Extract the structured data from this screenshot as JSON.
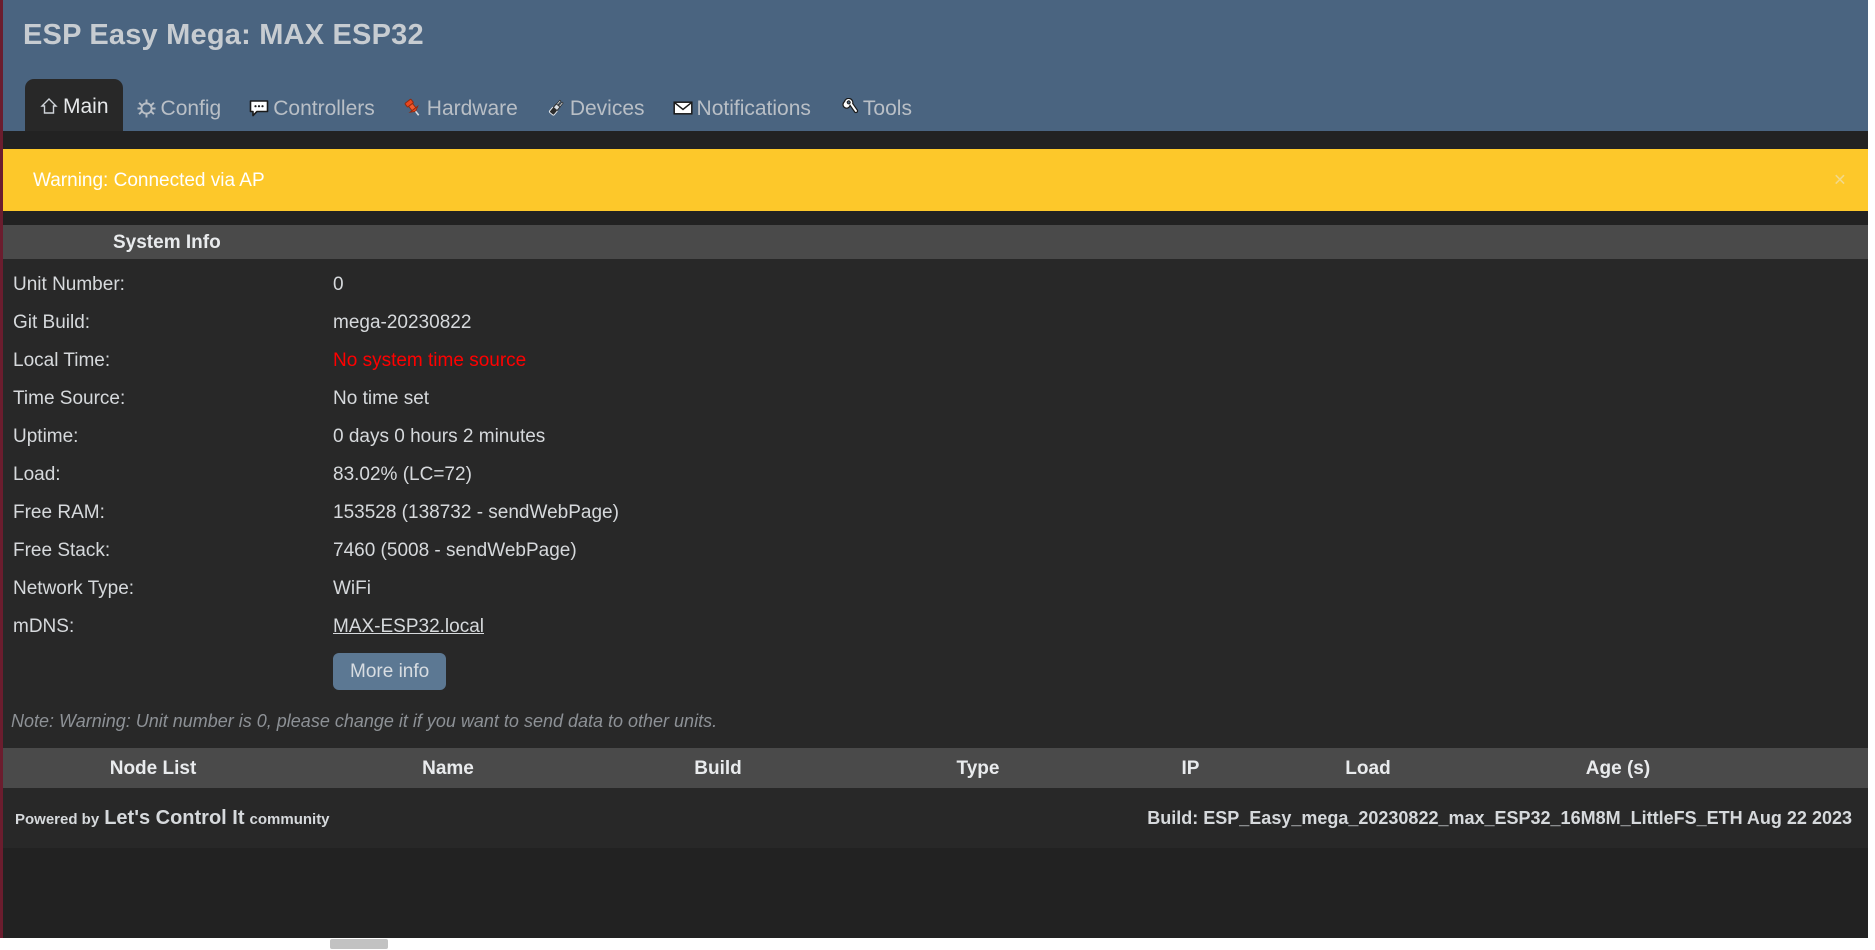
{
  "header": {
    "title": "ESP Easy Mega: MAX ESP32",
    "tabs": [
      {
        "label": "Main",
        "icon": "home-icon",
        "active": true
      },
      {
        "label": "Config",
        "icon": "gear-icon",
        "active": false
      },
      {
        "label": "Controllers",
        "icon": "chat-icon",
        "active": false
      },
      {
        "label": "Hardware",
        "icon": "pushpin-icon",
        "active": false
      },
      {
        "label": "Devices",
        "icon": "plug-icon",
        "active": false
      },
      {
        "label": "Notifications",
        "icon": "envelope-icon",
        "active": false
      },
      {
        "label": "Tools",
        "icon": "wrench-icon",
        "active": false
      }
    ]
  },
  "warning": {
    "text": "Warning: Connected via AP",
    "close_label": "×",
    "bg_color": "#fdc82a"
  },
  "system_info": {
    "heading": "System Info",
    "rows": [
      {
        "label": "Unit Number:",
        "value": "0",
        "style": "normal"
      },
      {
        "label": "Git Build:",
        "value": "mega-20230822",
        "style": "normal"
      },
      {
        "label": "Local Time:",
        "value": "No system time source",
        "style": "alert"
      },
      {
        "label": "Time Source:",
        "value": "No time set",
        "style": "normal"
      },
      {
        "label": "Uptime:",
        "value": "0 days 0 hours 2 minutes",
        "style": "normal"
      },
      {
        "label": "Load:",
        "value": "83.02% (LC=72)",
        "style": "normal"
      },
      {
        "label": "Free RAM:",
        "value": "153528 (138732 - sendWebPage)",
        "style": "normal"
      },
      {
        "label": "Free Stack:",
        "value": "7460 (5008 - sendWebPage)",
        "style": "normal"
      },
      {
        "label": "Network Type:",
        "value": "WiFi",
        "style": "normal"
      },
      {
        "label": "mDNS:",
        "value": "MAX-ESP32.local",
        "style": "link"
      }
    ],
    "more_info_button": "More info",
    "note": "Note: Warning: Unit number is 0, please change it if you want to send data to other units.",
    "alert_color": "#ff0000"
  },
  "node_list": {
    "columns": [
      "Node List",
      "Name",
      "Build",
      "Type",
      "IP",
      "Load",
      "Age (s)"
    ],
    "rows": []
  },
  "footer": {
    "powered_by": "Powered by",
    "brand": "Let's Control It",
    "brand_suffix": "community",
    "build": "Build: ESP_Easy_mega_20230822_max_ESP32_16M8M_LittleFS_ETH Aug 22 2023"
  }
}
